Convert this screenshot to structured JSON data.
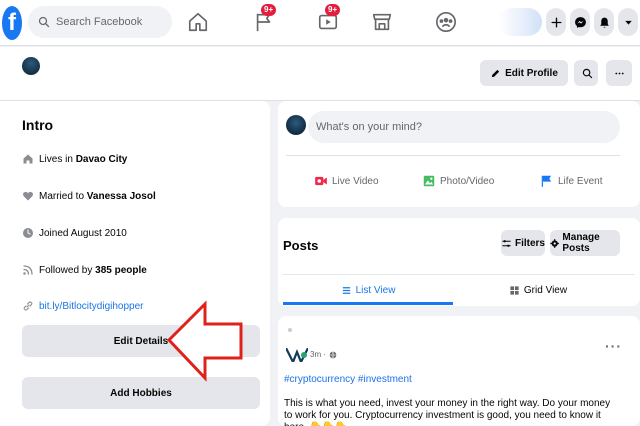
{
  "search": {
    "placeholder": "Search Facebook"
  },
  "nav": {
    "groups_badge": "9+",
    "watch_badge": "9+"
  },
  "profile_bar": {
    "edit_profile_label": "Edit Profile"
  },
  "intro": {
    "title": "Intro",
    "lives_prefix": "Lives in ",
    "lives_city": "Davao City",
    "married_prefix": "Married to ",
    "married_name": "Vanessa Josol",
    "joined": "Joined August 2010",
    "followed_prefix": "Followed by ",
    "followed_count": "385 people",
    "link": "bit.ly/Bitlocitydigihopper",
    "edit_details_label": "Edit Details",
    "add_hobbies_label": "Add Hobbies"
  },
  "composer": {
    "placeholder": "What's on your mind?",
    "live_video": "Live Video",
    "photo_video": "Photo/Video",
    "life_event": "Life Event"
  },
  "posts": {
    "title": "Posts",
    "filters_label": "Filters",
    "manage_label": "Manage Posts",
    "list_view": "List View",
    "grid_view": "Grid View"
  },
  "post": {
    "time": "3m",
    "more": "···",
    "tags": "#cryptocurrency #investment",
    "body": "This is what you need, invest your money in the right way. Do your money to work for you. Cryptocurrency investment is good, you need to know it here..👇👇👇"
  },
  "colors": {
    "brand": "#1877f2",
    "badge": "#e41e3f",
    "arrow": "#e0201b"
  },
  "icons": [
    "facebook-logo",
    "search-icon",
    "home-icon",
    "flag-icon",
    "watch-icon",
    "marketplace-icon",
    "groups-icon",
    "plus-icon",
    "messenger-icon",
    "bell-icon",
    "caret-down-icon",
    "pencil-icon",
    "eye-icon",
    "more-icon",
    "house-icon",
    "heart-icon",
    "clock-icon",
    "rss-icon",
    "live-video-icon",
    "photo-icon",
    "flag-event-icon",
    "filters-icon",
    "gear-icon",
    "list-icon",
    "grid-icon",
    "globe-icon"
  ]
}
